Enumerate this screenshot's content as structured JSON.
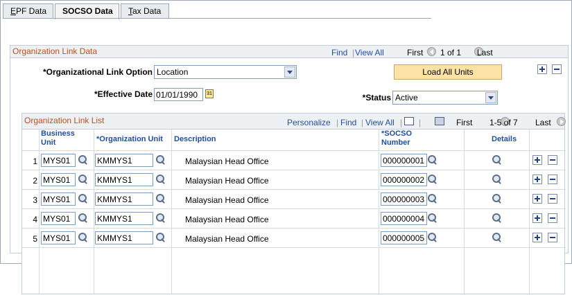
{
  "tabs": [
    {
      "label": "EPF Data",
      "accesskey": "E"
    },
    {
      "label": "SOCSO Data",
      "accesskey": ""
    },
    {
      "label": "Tax Data",
      "accesskey": "T"
    }
  ],
  "group": {
    "title": "Organization Link Data",
    "nav": {
      "find": "Find",
      "view_all": "View All",
      "first": "First",
      "range": "1 of 1",
      "last": "Last"
    },
    "org_link_option_label": "*Organizational Link Option",
    "org_link_option_value": "Location",
    "load_all_units": "Load All Units",
    "effective_date_label": "*Effective Date",
    "effective_date_value": "01/01/1990",
    "calendar_text": "31",
    "status_label": "*Status",
    "status_value": "Active"
  },
  "grid": {
    "title": "Organization Link List",
    "nav": {
      "personalize": "Personalize",
      "find": "Find",
      "view_all": "View All",
      "first": "First",
      "range": "1-5 of 7",
      "last": "Last"
    },
    "columns": {
      "business_unit": "Business Unit",
      "organization_unit": "*Organization Unit",
      "description": "Description",
      "socso_number": "*SOCSO Number",
      "details": "Details"
    },
    "rows": [
      {
        "num": "1",
        "business_unit": "MYS01",
        "org_unit": "KMMYS1",
        "description": "Malaysian Head Office",
        "socso": "000000001"
      },
      {
        "num": "2",
        "business_unit": "MYS01",
        "org_unit": "KMMYS1",
        "description": "Malaysian Head Office",
        "socso": "000000002"
      },
      {
        "num": "3",
        "business_unit": "MYS01",
        "org_unit": "KMMYS1",
        "description": "Malaysian Head Office",
        "socso": "000000003"
      },
      {
        "num": "4",
        "business_unit": "MYS01",
        "org_unit": "KMMYS1",
        "description": "Malaysian Head Office",
        "socso": "000000004"
      },
      {
        "num": "5",
        "business_unit": "MYS01",
        "org_unit": "KMMYS1",
        "description": "Malaysian Head Office",
        "socso": "000000005"
      }
    ]
  }
}
